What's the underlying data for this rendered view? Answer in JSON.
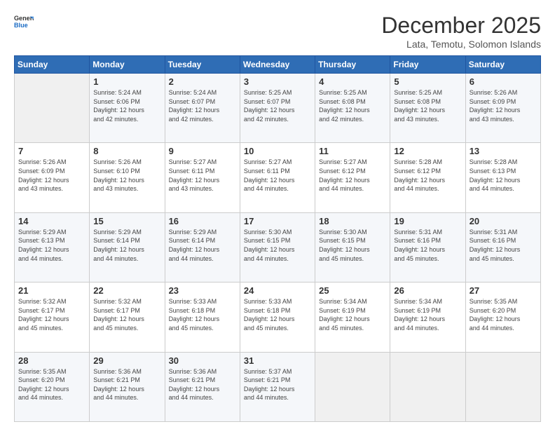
{
  "logo": {
    "general": "General",
    "blue": "Blue"
  },
  "header": {
    "month": "December 2025",
    "location": "Lata, Temotu, Solomon Islands"
  },
  "weekdays": [
    "Sunday",
    "Monday",
    "Tuesday",
    "Wednesday",
    "Thursday",
    "Friday",
    "Saturday"
  ],
  "weeks": [
    [
      {
        "day": "",
        "empty": true
      },
      {
        "day": "1",
        "sunrise": "5:24 AM",
        "sunset": "6:06 PM",
        "daylight": "12 hours and 42 minutes."
      },
      {
        "day": "2",
        "sunrise": "5:24 AM",
        "sunset": "6:07 PM",
        "daylight": "12 hours and 42 minutes."
      },
      {
        "day": "3",
        "sunrise": "5:25 AM",
        "sunset": "6:07 PM",
        "daylight": "12 hours and 42 minutes."
      },
      {
        "day": "4",
        "sunrise": "5:25 AM",
        "sunset": "6:08 PM",
        "daylight": "12 hours and 42 minutes."
      },
      {
        "day": "5",
        "sunrise": "5:25 AM",
        "sunset": "6:08 PM",
        "daylight": "12 hours and 43 minutes."
      },
      {
        "day": "6",
        "sunrise": "5:26 AM",
        "sunset": "6:09 PM",
        "daylight": "12 hours and 43 minutes."
      }
    ],
    [
      {
        "day": "7",
        "sunrise": "5:26 AM",
        "sunset": "6:09 PM",
        "daylight": "12 hours and 43 minutes."
      },
      {
        "day": "8",
        "sunrise": "5:26 AM",
        "sunset": "6:10 PM",
        "daylight": "12 hours and 43 minutes."
      },
      {
        "day": "9",
        "sunrise": "5:27 AM",
        "sunset": "6:11 PM",
        "daylight": "12 hours and 43 minutes."
      },
      {
        "day": "10",
        "sunrise": "5:27 AM",
        "sunset": "6:11 PM",
        "daylight": "12 hours and 44 minutes."
      },
      {
        "day": "11",
        "sunrise": "5:27 AM",
        "sunset": "6:12 PM",
        "daylight": "12 hours and 44 minutes."
      },
      {
        "day": "12",
        "sunrise": "5:28 AM",
        "sunset": "6:12 PM",
        "daylight": "12 hours and 44 minutes."
      },
      {
        "day": "13",
        "sunrise": "5:28 AM",
        "sunset": "6:13 PM",
        "daylight": "12 hours and 44 minutes."
      }
    ],
    [
      {
        "day": "14",
        "sunrise": "5:29 AM",
        "sunset": "6:13 PM",
        "daylight": "12 hours and 44 minutes."
      },
      {
        "day": "15",
        "sunrise": "5:29 AM",
        "sunset": "6:14 PM",
        "daylight": "12 hours and 44 minutes."
      },
      {
        "day": "16",
        "sunrise": "5:29 AM",
        "sunset": "6:14 PM",
        "daylight": "12 hours and 44 minutes."
      },
      {
        "day": "17",
        "sunrise": "5:30 AM",
        "sunset": "6:15 PM",
        "daylight": "12 hours and 44 minutes."
      },
      {
        "day": "18",
        "sunrise": "5:30 AM",
        "sunset": "6:15 PM",
        "daylight": "12 hours and 45 minutes."
      },
      {
        "day": "19",
        "sunrise": "5:31 AM",
        "sunset": "6:16 PM",
        "daylight": "12 hours and 45 minutes."
      },
      {
        "day": "20",
        "sunrise": "5:31 AM",
        "sunset": "6:16 PM",
        "daylight": "12 hours and 45 minutes."
      }
    ],
    [
      {
        "day": "21",
        "sunrise": "5:32 AM",
        "sunset": "6:17 PM",
        "daylight": "12 hours and 45 minutes."
      },
      {
        "day": "22",
        "sunrise": "5:32 AM",
        "sunset": "6:17 PM",
        "daylight": "12 hours and 45 minutes."
      },
      {
        "day": "23",
        "sunrise": "5:33 AM",
        "sunset": "6:18 PM",
        "daylight": "12 hours and 45 minutes."
      },
      {
        "day": "24",
        "sunrise": "5:33 AM",
        "sunset": "6:18 PM",
        "daylight": "12 hours and 45 minutes."
      },
      {
        "day": "25",
        "sunrise": "5:34 AM",
        "sunset": "6:19 PM",
        "daylight": "12 hours and 45 minutes."
      },
      {
        "day": "26",
        "sunrise": "5:34 AM",
        "sunset": "6:19 PM",
        "daylight": "12 hours and 44 minutes."
      },
      {
        "day": "27",
        "sunrise": "5:35 AM",
        "sunset": "6:20 PM",
        "daylight": "12 hours and 44 minutes."
      }
    ],
    [
      {
        "day": "28",
        "sunrise": "5:35 AM",
        "sunset": "6:20 PM",
        "daylight": "12 hours and 44 minutes."
      },
      {
        "day": "29",
        "sunrise": "5:36 AM",
        "sunset": "6:21 PM",
        "daylight": "12 hours and 44 minutes."
      },
      {
        "day": "30",
        "sunrise": "5:36 AM",
        "sunset": "6:21 PM",
        "daylight": "12 hours and 44 minutes."
      },
      {
        "day": "31",
        "sunrise": "5:37 AM",
        "sunset": "6:21 PM",
        "daylight": "12 hours and 44 minutes."
      },
      {
        "day": "",
        "empty": true
      },
      {
        "day": "",
        "empty": true
      },
      {
        "day": "",
        "empty": true
      }
    ]
  ],
  "labels": {
    "sunrise_prefix": "Sunrise: ",
    "sunset_prefix": "Sunset: ",
    "daylight_prefix": "Daylight: "
  }
}
